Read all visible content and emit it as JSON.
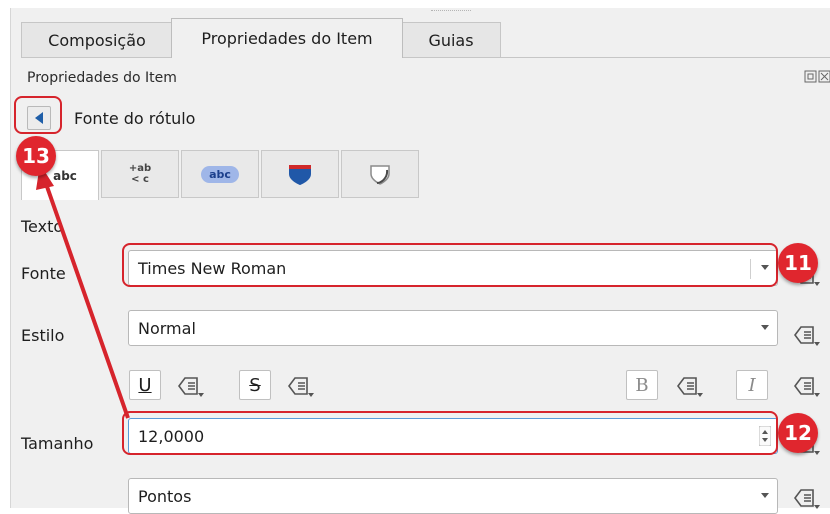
{
  "tabs": [
    "Composição",
    "Propriedades do Item",
    "Guias"
  ],
  "section_title": "Propriedades do Item",
  "back_label": "Fonte do rótulo",
  "subtabs": {
    "text": "abc",
    "format": "+ab",
    "format2": "< c",
    "background": "abc"
  },
  "labels": {
    "texto": "Texto",
    "fonte": "Fonte",
    "estilo": "Estilo",
    "tamanho": "Tamanho"
  },
  "font_value": "Times New Roman",
  "style_value": "Normal",
  "size_value": "12,0000",
  "unit_value": "Pontos",
  "format_buttons": {
    "underline": "U",
    "strikeout": "S",
    "bold": "B",
    "italic": "I"
  },
  "badges": [
    "11",
    "12",
    "13"
  ],
  "colors": {
    "highlight": "#d6242c",
    "badge": "#e0262e",
    "focus": "#5a9bd8"
  }
}
